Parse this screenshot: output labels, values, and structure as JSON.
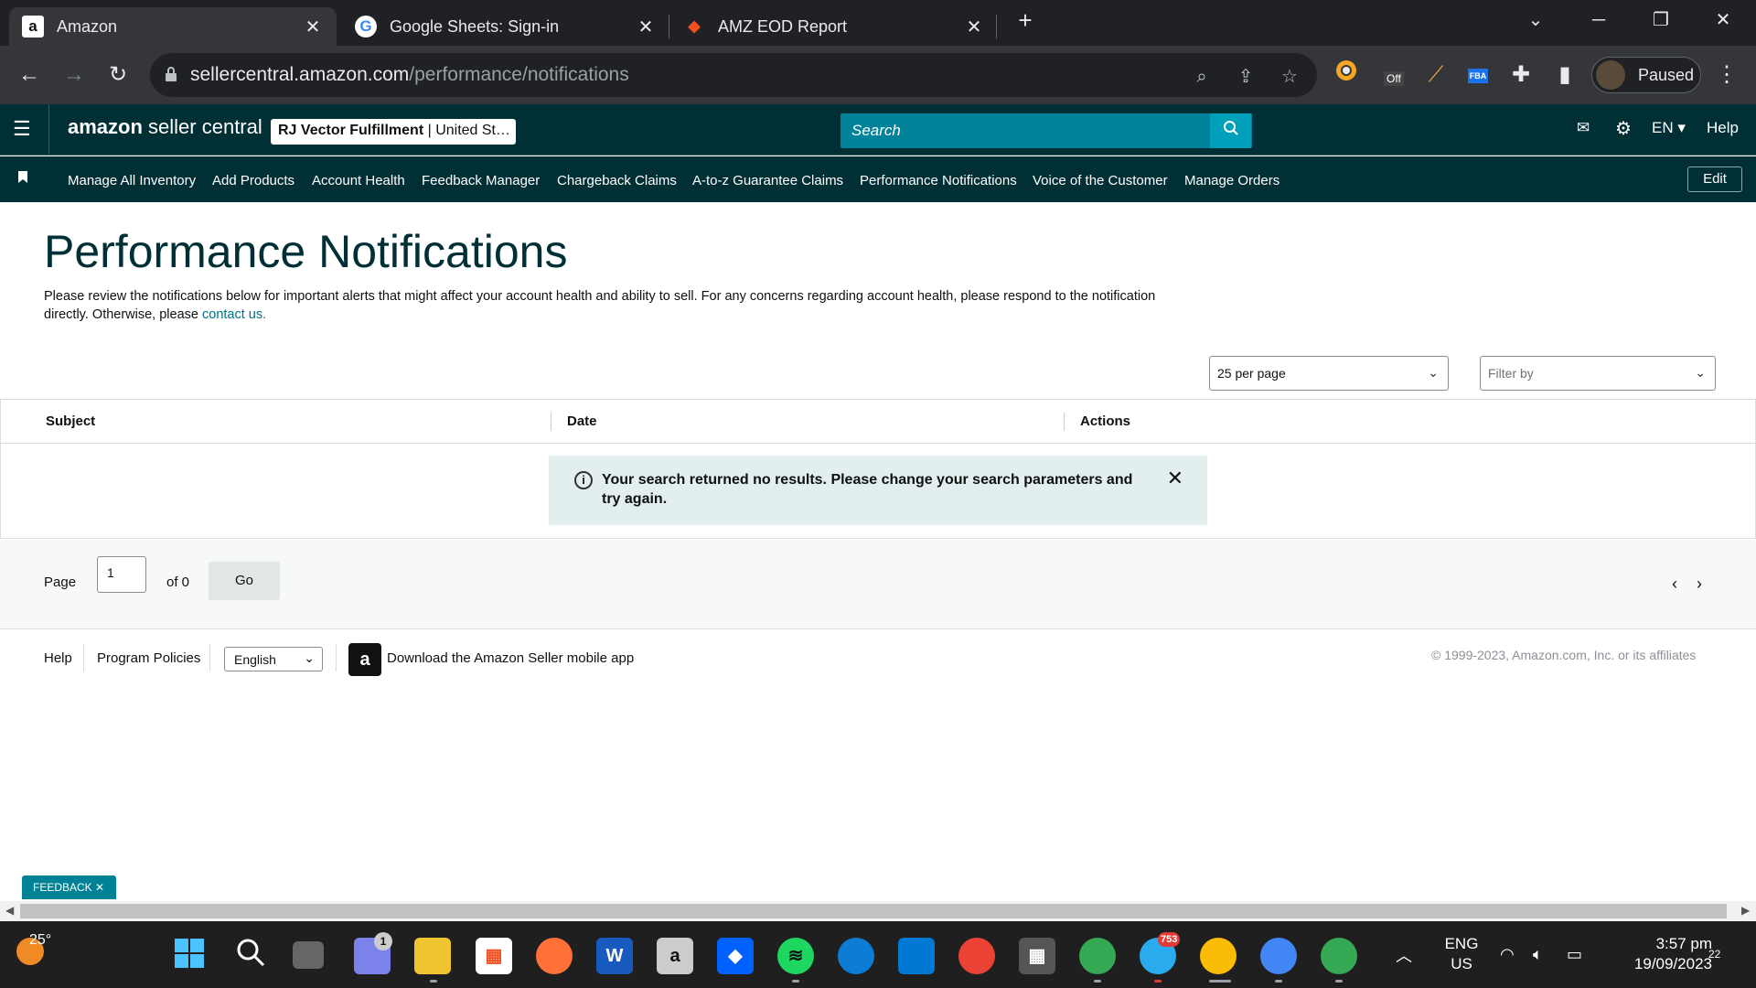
{
  "browser": {
    "tabs": [
      {
        "title": "Amazon",
        "favicon": "a",
        "active": true
      },
      {
        "title": "Google Sheets: Sign-in",
        "favicon": "G",
        "active": false
      },
      {
        "title": "AMZ EOD Report",
        "favicon": "◆",
        "active": false
      }
    ],
    "new_tab": "+",
    "url_domain": "sellercentral.amazon.com",
    "url_path": "/performance/notifications",
    "profile_label": "Paused",
    "extension_badge": "Off",
    "extension_fba": "FBA"
  },
  "seller_header": {
    "logo_bold": "amazon",
    "logo_rest": " seller central",
    "account_name": "RJ Vector Fulfillment",
    "account_region": " | United St…",
    "search_placeholder": "Search",
    "language": "EN ▾",
    "help": "Help"
  },
  "nav": {
    "items": [
      "Manage All Inventory",
      "Add Products",
      "Account Health",
      "Feedback Manager",
      "Chargeback Claims",
      "A-to-z Guarantee Claims",
      "Performance Notifications",
      "Voice of the Customer",
      "Manage Orders"
    ],
    "edit": "Edit"
  },
  "main": {
    "title": "Performance Notifications",
    "intro": "Please review the notifications below for important alerts that might affect your account health and ability to sell. For any concerns regarding account health, please respond to the notification directly. Otherwise, please ",
    "intro_link": "contact us.",
    "per_page": "25 per page",
    "filter_placeholder": "Filter by",
    "columns": [
      "Subject",
      "Date",
      "Actions"
    ],
    "alert": "Your search returned no results. Please change your search parameters and try again.",
    "pager": {
      "label": "Page",
      "value": "1",
      "of": "of 0",
      "go": "Go"
    }
  },
  "footer": {
    "help": "Help",
    "policies": "Program Policies",
    "language": "English",
    "app_link": "Download the Amazon Seller mobile app",
    "copyright": "© 1999-2023, Amazon.com, Inc. or its affiliates"
  },
  "feedback": "FEEDBACK ✕",
  "taskbar": {
    "weather": "25°",
    "chat_badge": "1",
    "telegram_badge": "753",
    "lang_top": "ENG",
    "lang_bottom": "US",
    "time": "3:57 pm",
    "date": "19/09/2023",
    "notif_badge": "22"
  }
}
